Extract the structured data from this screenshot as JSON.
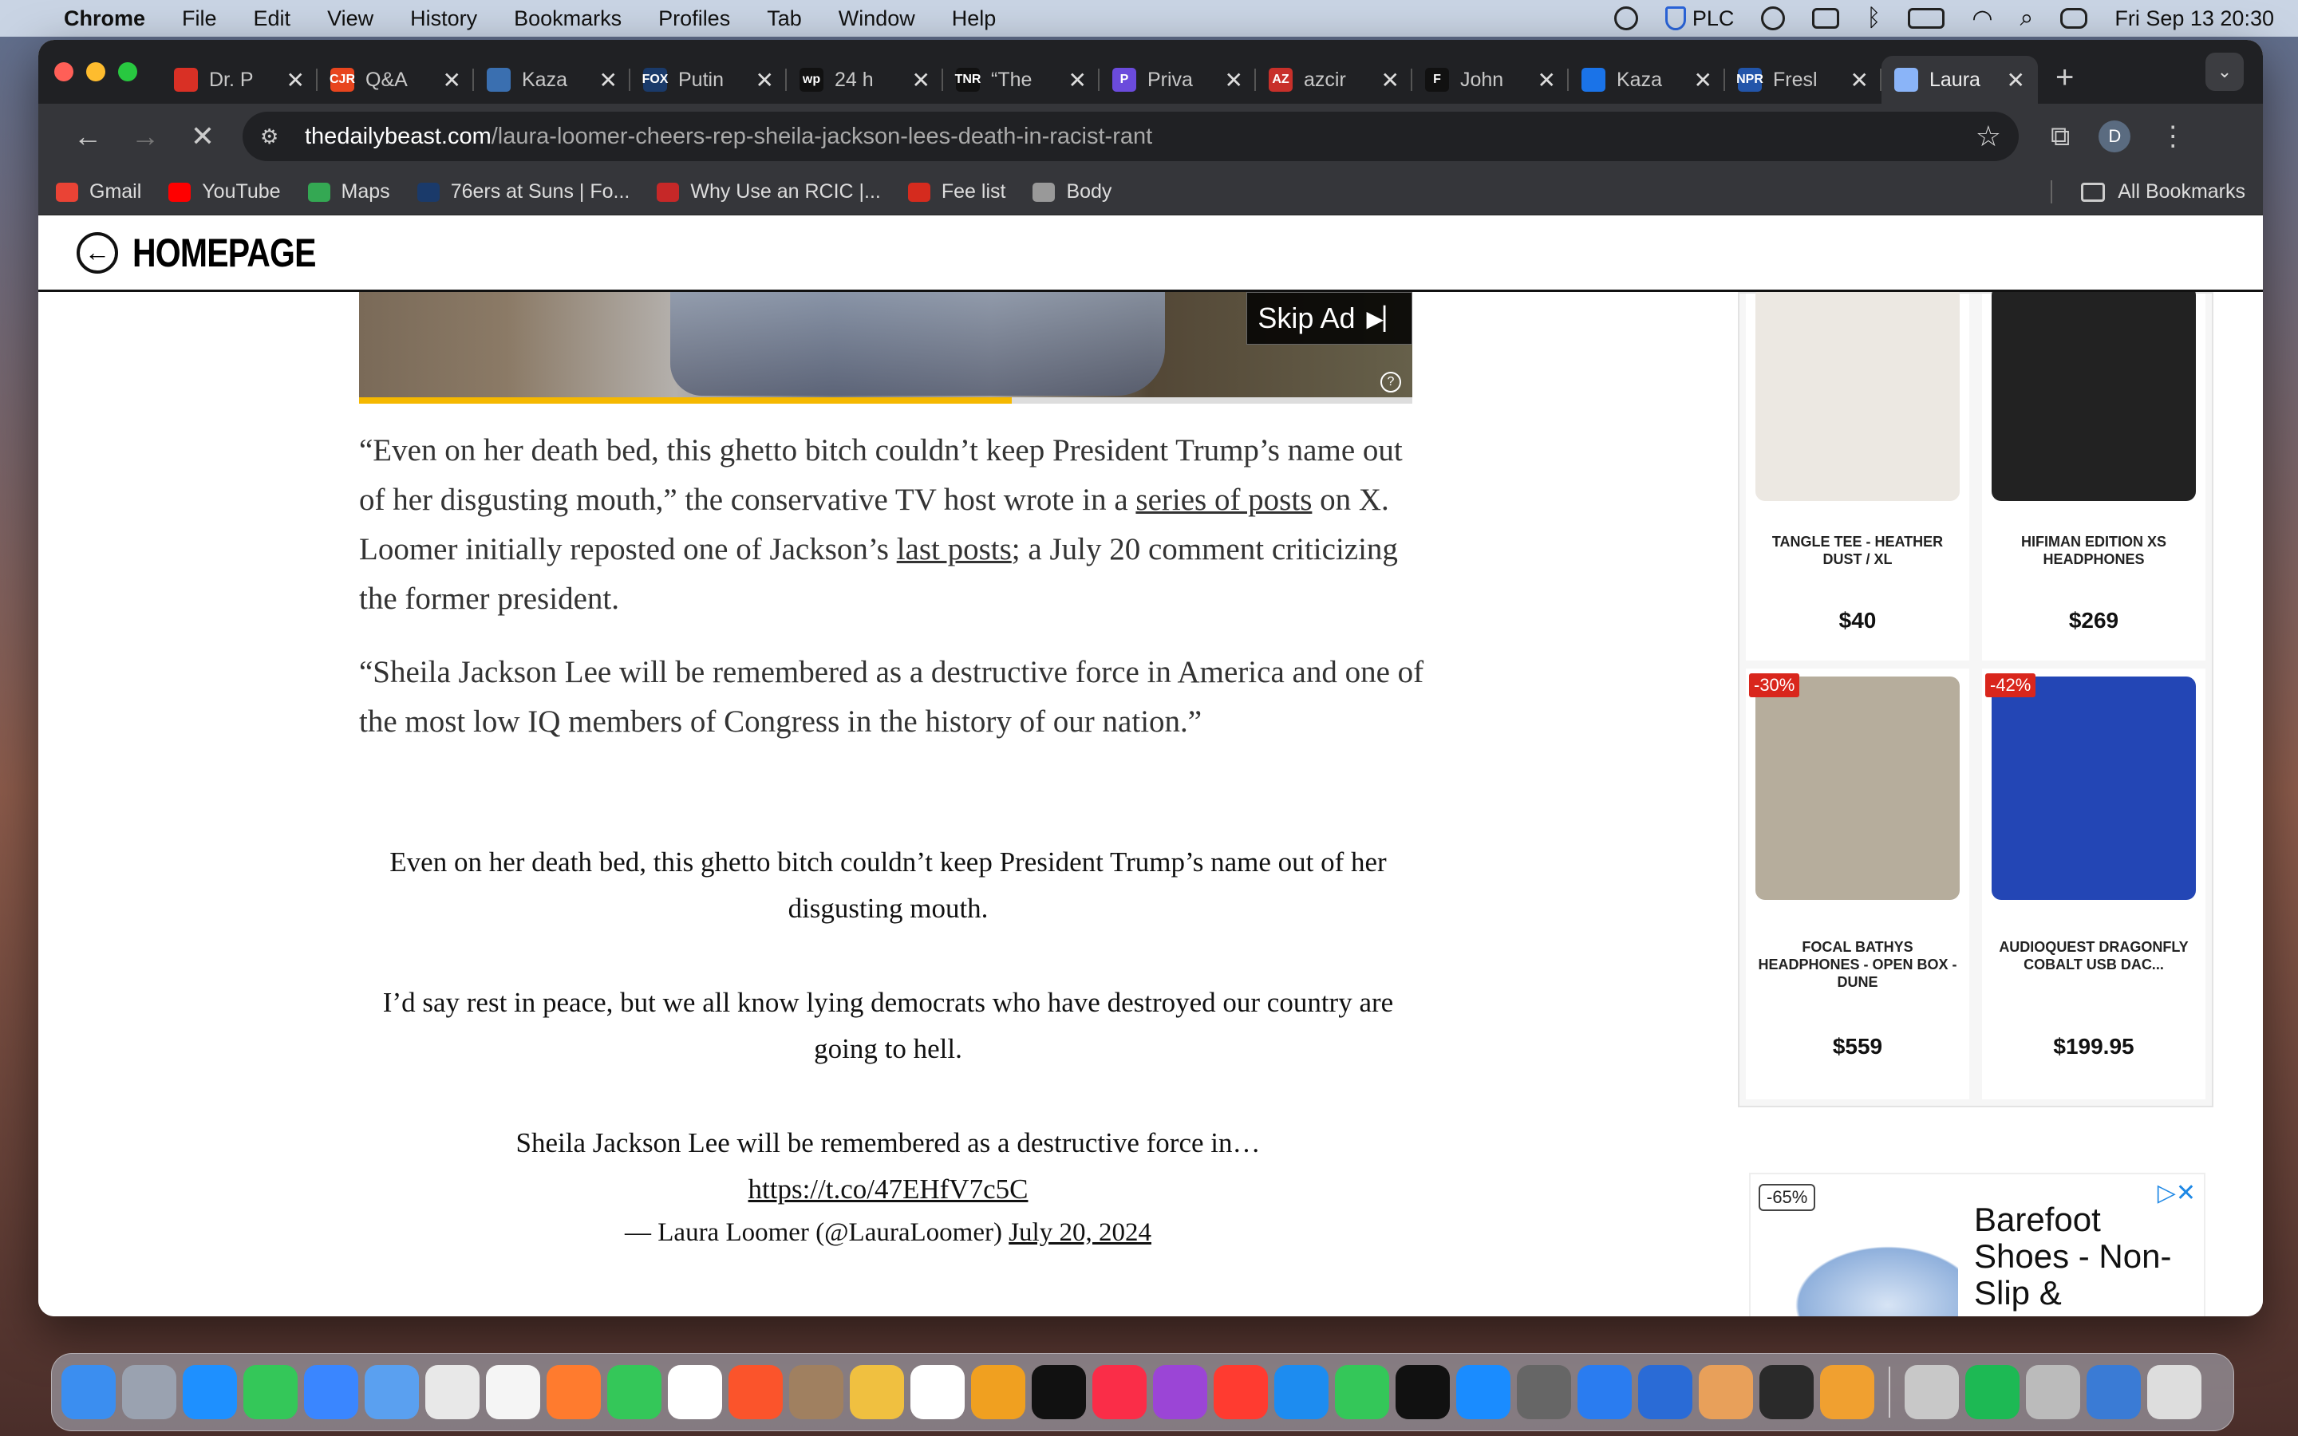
{
  "menubar": {
    "app": "Chrome",
    "menus": [
      "File",
      "Edit",
      "View",
      "History",
      "Bookmarks",
      "Profiles",
      "Tab",
      "Window",
      "Help"
    ],
    "vpn_label": "PLC",
    "datetime": "Fri Sep 13  20:30"
  },
  "tabs": [
    {
      "title": "Dr. P",
      "color": "#d93025",
      "glyph": ""
    },
    {
      "title": "Q&A",
      "color": "#e8451e",
      "glyph": "CJR"
    },
    {
      "title": "Kaza",
      "color": "#3a6fb0",
      "glyph": ""
    },
    {
      "title": "Putin",
      "color": "#1a3a6a",
      "glyph": "FOX"
    },
    {
      "title": "24 h",
      "color": "#111",
      "glyph": "wp"
    },
    {
      "title": "“The",
      "color": "#111",
      "glyph": "TNR"
    },
    {
      "title": "Priva",
      "color": "#6b4bdc",
      "glyph": "P"
    },
    {
      "title": "azcir",
      "color": "#c8302a",
      "glyph": "AZ"
    },
    {
      "title": "John",
      "color": "#111",
      "glyph": "F"
    },
    {
      "title": "Kaza",
      "color": "#1a73e8",
      "glyph": ""
    },
    {
      "title": "Fresl",
      "color": "#2255aa",
      "glyph": "NPR"
    },
    {
      "title": "Laura",
      "color": "#8ab4f8",
      "glyph": "",
      "active": true
    }
  ],
  "toolbar": {
    "url_host": "thedailybeast.com",
    "url_path": "/laura-loomer-cheers-rep-sheila-jackson-lees-death-in-racist-rant",
    "avatar_letter": "D"
  },
  "bookmarks": [
    {
      "label": "Gmail",
      "color": "#ea4335"
    },
    {
      "label": "YouTube",
      "color": "#ff0000"
    },
    {
      "label": "Maps",
      "color": "#34a853"
    },
    {
      "label": "76ers at Suns | Fo...",
      "color": "#1a3a6a"
    },
    {
      "label": "Why Use an RCIC |...",
      "color": "#c62828"
    },
    {
      "label": "Fee list",
      "color": "#d52b1e"
    },
    {
      "label": "Body",
      "color": "#999"
    }
  ],
  "bookmarks_all": "All Bookmarks",
  "header": {
    "home_label": "HOMEPAGE"
  },
  "video": {
    "skip_label": "Skip Ad",
    "progress": 0.62
  },
  "article": {
    "p1_a": "“Even on her death bed, this ghetto bitch couldn’t keep President Trump’s name out of her disgusting mouth,” the conservative TV host wrote in a ",
    "p1_link1": "series of posts",
    "p1_b": " on X. Loomer initially reposted one of Jackson’s ",
    "p1_link2": "last posts",
    "p1_c": "; a July 20 comment criticizing the former president.",
    "p2": "“Sheila Jackson Lee will be remembered as a destructive force in America and one of the most low IQ members of Congress in the history of our nation.”"
  },
  "tweet": {
    "line1": "Even on her death bed, this ghetto bitch couldn’t keep President Trump’s name out of her disgusting mouth.",
    "line2": "I’d say rest in peace, but we all know lying democrats who have destroyed our country are going to hell.",
    "line3": "Sheila Jackson Lee will be remembered as a destructive force in…",
    "link": "https://t.co/47EHfV7c5C",
    "author": "— Laura Loomer (@LauraLoomer) ",
    "date": "July 20, 2024"
  },
  "rail": {
    "products": [
      {
        "name": "TANGLE TEE - HEATHER DUST / XL",
        "price": "$40",
        "badge": "",
        "color": "#ece8e2"
      },
      {
        "name": "HIFIMAN EDITION XS HEADPHONES",
        "price": "$269",
        "badge": "",
        "color": "#222"
      },
      {
        "name": "FOCAL BATHYS HEADPHONES - OPEN BOX - DUNE",
        "price": "$559",
        "badge": "-30%",
        "color": "#b6ad9c"
      },
      {
        "name": "AUDIOQUEST DRAGONFLY COBALT USB DAC...",
        "price": "$199.95",
        "badge": "-42%",
        "color": "#2346b5"
      }
    ]
  },
  "ad2": {
    "discount": "-65%",
    "title": "Barefoot Shoes - Non-Slip &"
  },
  "dock": {
    "apps": [
      "#3b8ef0",
      "#9aa2b0",
      "#1e90ff",
      "#34c759",
      "#3a86ff",
      "#5aa0f0",
      "#e8e8e8",
      "#f5f5f5",
      "#ff7b2e",
      "#34c759",
      "#ffffff",
      "#fb542b",
      "#a08060",
      "#f0c040",
      "#ffffff",
      "#f0a020",
      "#111111",
      "#fa2d48",
      "#9b45d6",
      "#ff3b30",
      "#1d8cf0",
      "#34c759",
      "#111111",
      "#1a8cff",
      "#666666",
      "#2a7cf0",
      "#2a6bd6",
      "#e8a05a",
      "#2a2a2a",
      "#f0a030",
      "#c8c8c8",
      "#1db954",
      "#bbbbbb",
      "#3a7bd5",
      "#dddddd"
    ]
  }
}
